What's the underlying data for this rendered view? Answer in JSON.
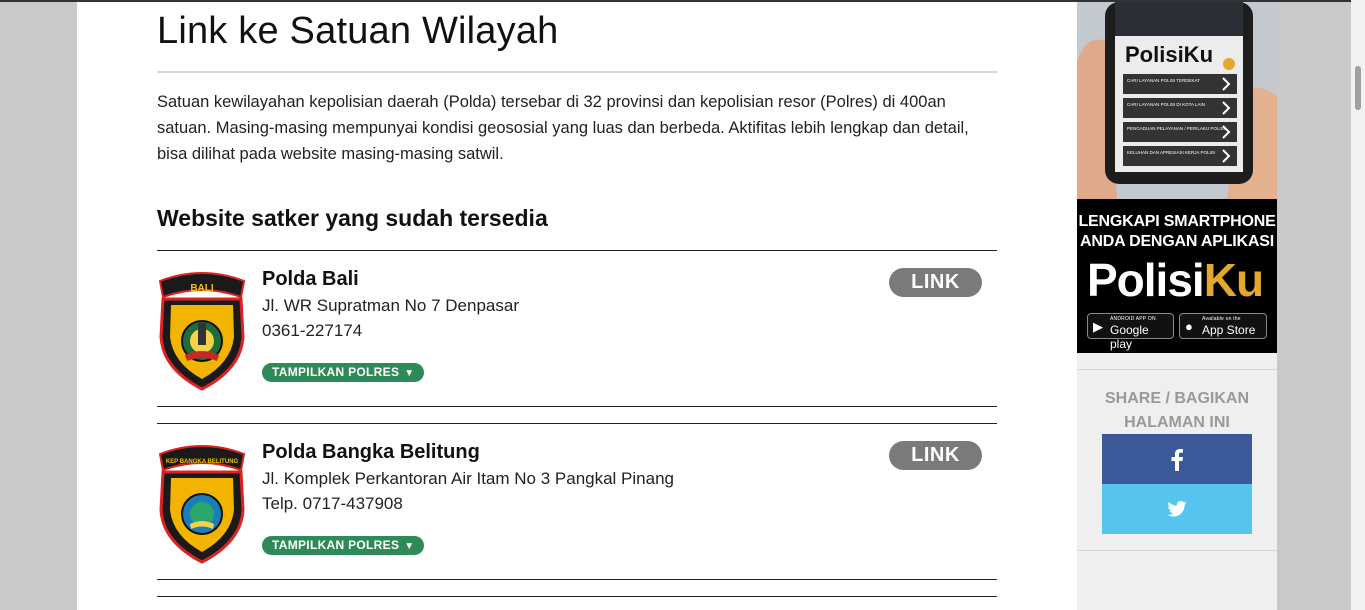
{
  "page": {
    "title": "Link ke Satuan Wilayah",
    "intro_lines": [
      "Satuan kewilayahan kepolisian daerah (Polda) tersebar di 32 provinsi dan kepolisian resor (Polres) di 400an",
      "satuan. Masing-masing mempunyai kondisi geososial yang luas dan berbeda. Aktifitas lebih lengkap dan detail,",
      "bisa dilihat pada website masing-masing satwil."
    ],
    "section_heading": "Website satker yang sudah tersedia"
  },
  "entries": [
    {
      "emblem_banner": "BALI",
      "name": "Polda Bali",
      "address": "Jl. WR Supratman No 7 Denpasar",
      "phone": "0361-227174",
      "polres_label": "TAMPILKAN POLRES",
      "link_label": "LINK"
    },
    {
      "emblem_banner": "KEP BANGKA BELITUNG",
      "name": "Polda Bangka Belitung",
      "address": "Jl. Komplek Perkantoran Air Itam No 3 Pangkal Pinang",
      "phone": "Telp. 0717-437908",
      "polres_label": "TAMPILKAN POLRES",
      "link_label": "LINK"
    }
  ],
  "sidebar": {
    "ad": {
      "phone_brand": "PolisiKu",
      "phone_menu": [
        "CARI LAYANAN POLISI TERDEKAT",
        "CARI LAYANAN POLISI DI KOTA LAIN",
        "PENGADUAN PELAYANAN / PERILAKU POLISI",
        "KELUHAN DAN APRESIASI KERJA POLISI"
      ],
      "tagline_line1": "LENGKAPI SMARTPHONE",
      "tagline_line2": "ANDA DENGAN APLIKASI",
      "brand_a": "Polisi",
      "brand_b": "Ku",
      "google_small": "ANDROID APP ON",
      "google_big": "Google play",
      "apple_small": "Available on the",
      "apple_big": "App Store"
    },
    "share_line1": "SHARE / BAGIKAN",
    "share_line2": "HALAMAN INI"
  },
  "colors": {
    "polres_green": "#2e8b57",
    "link_gray": "#7a7a7a",
    "facebook": "#3b5998",
    "twitter": "#55c5ef",
    "brand_gold": "#e3a92e"
  },
  "icons": {
    "facebook": "facebook-icon",
    "twitter": "twitter-icon",
    "caret": "caret-down-icon"
  }
}
